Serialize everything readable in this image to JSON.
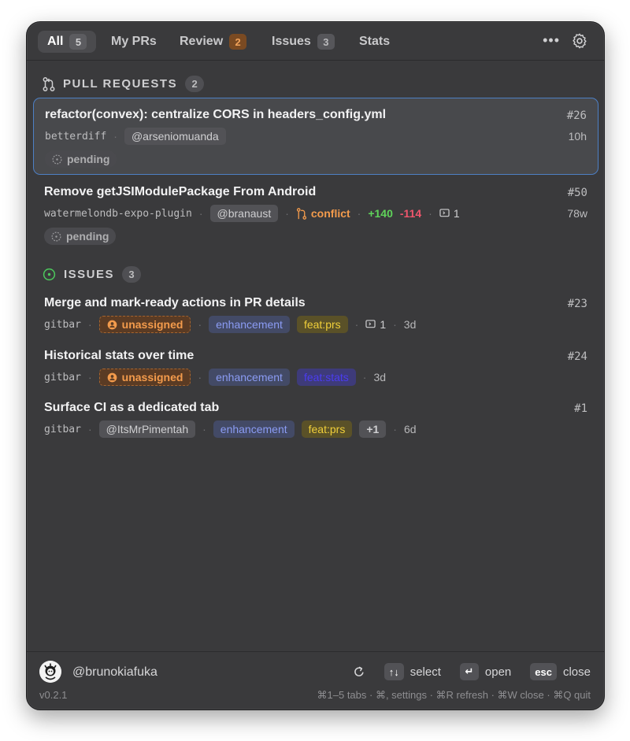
{
  "tabs": [
    {
      "label": "All",
      "count": "5"
    },
    {
      "label": "My PRs"
    },
    {
      "label": "Review",
      "count": "2"
    },
    {
      "label": "Issues",
      "count": "3"
    },
    {
      "label": "Stats"
    }
  ],
  "toolbar": {
    "more": "•••"
  },
  "pull_requests": {
    "heading": "PULL REQUESTS",
    "count": "2",
    "items": [
      {
        "title": "refactor(convex): centralize CORS in headers_config.yml",
        "number": "#26",
        "repo": "betterdiff",
        "author": "@arseniomuanda",
        "age": "10h",
        "status": "pending"
      },
      {
        "title": "Remove getJSIModulePackage From Android",
        "number": "#50",
        "repo": "watermelondb-expo-plugin",
        "author": "@branaust",
        "conflict": "conflict",
        "additions": "+140",
        "deletions": "-114",
        "comments": "1",
        "age": "78w",
        "status": "pending"
      }
    ]
  },
  "issues": {
    "heading": "ISSUES",
    "count": "3",
    "items": [
      {
        "title": "Merge and mark-ready actions in PR details",
        "number": "#23",
        "repo": "gitbar",
        "assignee": "unassigned",
        "labels": [
          "enhancement",
          "feat:prs"
        ],
        "comments": "1",
        "age": "3d"
      },
      {
        "title": "Historical stats over time",
        "number": "#24",
        "repo": "gitbar",
        "assignee": "unassigned",
        "labels": [
          "enhancement",
          "feat:stats"
        ],
        "age": "3d"
      },
      {
        "title": "Surface CI as a dedicated tab",
        "number": "#1",
        "repo": "gitbar",
        "assignee": "@ItsMrPimentah",
        "labels": [
          "enhancement",
          "feat:prs"
        ],
        "extra_labels": "+1",
        "age": "6d"
      }
    ]
  },
  "footer": {
    "username": "@brunokiafuka",
    "version": "v0.2.1",
    "keys": {
      "select_key": "↑↓",
      "select_label": "select",
      "open_key": "↵",
      "open_label": "open",
      "close_key": "esc",
      "close_label": "close"
    },
    "shortcuts": "⌘1–5 tabs · ⌘, settings · ⌘R refresh · ⌘W close · ⌘Q quit"
  },
  "colors": {
    "accent_border": "#4d7fc4",
    "additions": "#5fd35a",
    "deletions": "#f0566c",
    "conflict": "#f39b4c",
    "issue_open": "#4cc75c"
  }
}
